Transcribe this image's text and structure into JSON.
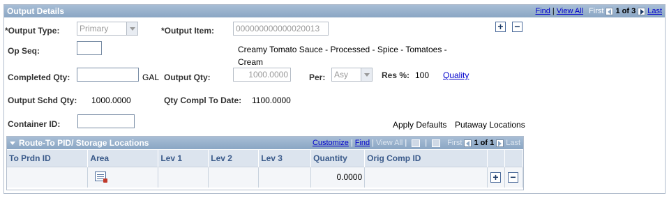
{
  "panel": {
    "title": "Output Details",
    "nav": {
      "find": "Find",
      "view_all": "View All",
      "first": "First",
      "range": "1 of 3",
      "last": "Last"
    }
  },
  "form": {
    "output_type_label": "*Output Type:",
    "output_type_value": "Primary",
    "output_item_label": "*Output Item:",
    "output_item_value": "000000000000020013",
    "item_description_line1": "Creamy Tomato Sauce - Processed - Spice - Tomatoes -",
    "item_description_line2": "Cream",
    "op_seq_label": "Op Seq:",
    "op_seq_value": "",
    "completed_qty_label": "Completed Qty:",
    "completed_qty_value": "",
    "uom": "GAL",
    "output_qty_label": "Output Qty:",
    "output_qty_value": "1000.0000",
    "per_label": "Per:",
    "per_value": "Asy",
    "res_pct_label": "Res %:",
    "res_pct_value": "100",
    "quality_link": "Quality",
    "output_schd_qty_label": "Output Schd Qty:",
    "output_schd_qty_value": "1000.0000",
    "qty_compl_label": "Qty Compl To Date:",
    "qty_compl_value": "1100.0000",
    "container_id_label": "Container ID:",
    "container_id_value": "",
    "apply_defaults": "Apply Defaults",
    "putaway_locations": "Putaway Locations",
    "add_symbol": "+",
    "remove_symbol": "−"
  },
  "grid": {
    "title": "Route-To PID/ Storage Locations",
    "nav": {
      "customize": "Customize",
      "find": "Find",
      "view_all": "View All",
      "first": "First",
      "range": "1 of 1",
      "last": "Last"
    },
    "columns": [
      "To Prdn ID",
      "Area",
      "Lev 1",
      "Lev 2",
      "Lev 3",
      "Quantity",
      "Orig Comp ID"
    ],
    "rows": [
      {
        "to_prdn_id": "",
        "area": "",
        "lev1": "",
        "lev2": "",
        "lev3": "",
        "quantity": "0.0000",
        "orig_comp_id": ""
      }
    ]
  }
}
